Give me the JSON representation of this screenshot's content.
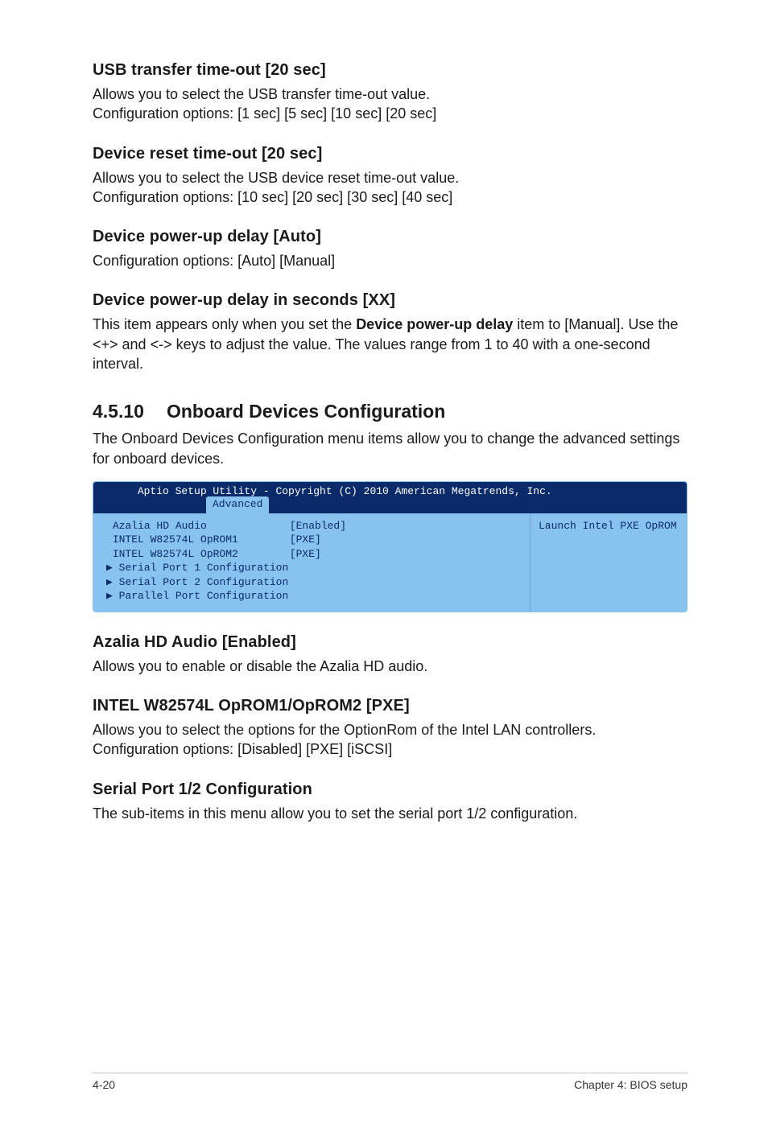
{
  "sections": {
    "usb_transfer": {
      "heading": "USB transfer time-out [20 sec]",
      "p1": "Allows you to select the USB transfer time-out value.",
      "p2": "Configuration options: [1 sec] [5 sec] [10 sec] [20 sec]"
    },
    "device_reset": {
      "heading": "Device reset time-out [20 sec]",
      "p1": "Allows you to select the USB device reset time-out value.",
      "p2": "Configuration options: [10 sec] [20 sec] [30 sec] [40 sec]"
    },
    "power_up": {
      "heading": "Device power-up delay [Auto]",
      "p1": "Configuration options: [Auto] [Manual]"
    },
    "power_up_sec": {
      "heading": "Device power-up delay in seconds [XX]",
      "p1_a": "This item appears only when you set the ",
      "p1_bold": "Device power-up delay",
      "p1_b": " item to [Manual]. Use the <+> and <-> keys to adjust the value. The values range from 1 to 40 with a one-second interval."
    },
    "onboard": {
      "number": "4.5.10",
      "title": "Onboard Devices Configuration",
      "desc": "The Onboard Devices Configuration menu items allow you to change the advanced settings for onboard devices."
    },
    "azalia": {
      "heading": "Azalia HD Audio [Enabled]",
      "p1": "Allows you to enable or disable the Azalia HD audio."
    },
    "intel_oprom": {
      "heading": "INTEL W82574L OpROM1/OpROM2 [PXE]",
      "p1": "Allows you to select the options for the OptionRom of the Intel LAN controllers.",
      "p2": "Configuration options: [Disabled] [PXE] [iSCSI]"
    },
    "serial_port": {
      "heading": "Serial Port 1/2 Configuration",
      "p1": "The sub-items in this menu allow you to set the serial port 1/2 configuration."
    }
  },
  "bios": {
    "title": "Aptio Setup Utility - Copyright (C) 2010 American Megatrends, Inc.",
    "tab": "Advanced",
    "rows": [
      {
        "label": "Azalia HD Audio",
        "value": "[Enabled]"
      },
      {
        "label": "INTEL W82574L OpROM1",
        "value": "[PXE]"
      },
      {
        "label": "INTEL W82574L OpROM2",
        "value": "[PXE]"
      }
    ],
    "subs": [
      "Serial Port 1 Configuration",
      "Serial Port 2 Configuration",
      "Parallel Port Configuration"
    ],
    "help": "Launch Intel PXE OpROM"
  },
  "footer": {
    "left": "4-20",
    "right": "Chapter 4: BIOS setup"
  }
}
